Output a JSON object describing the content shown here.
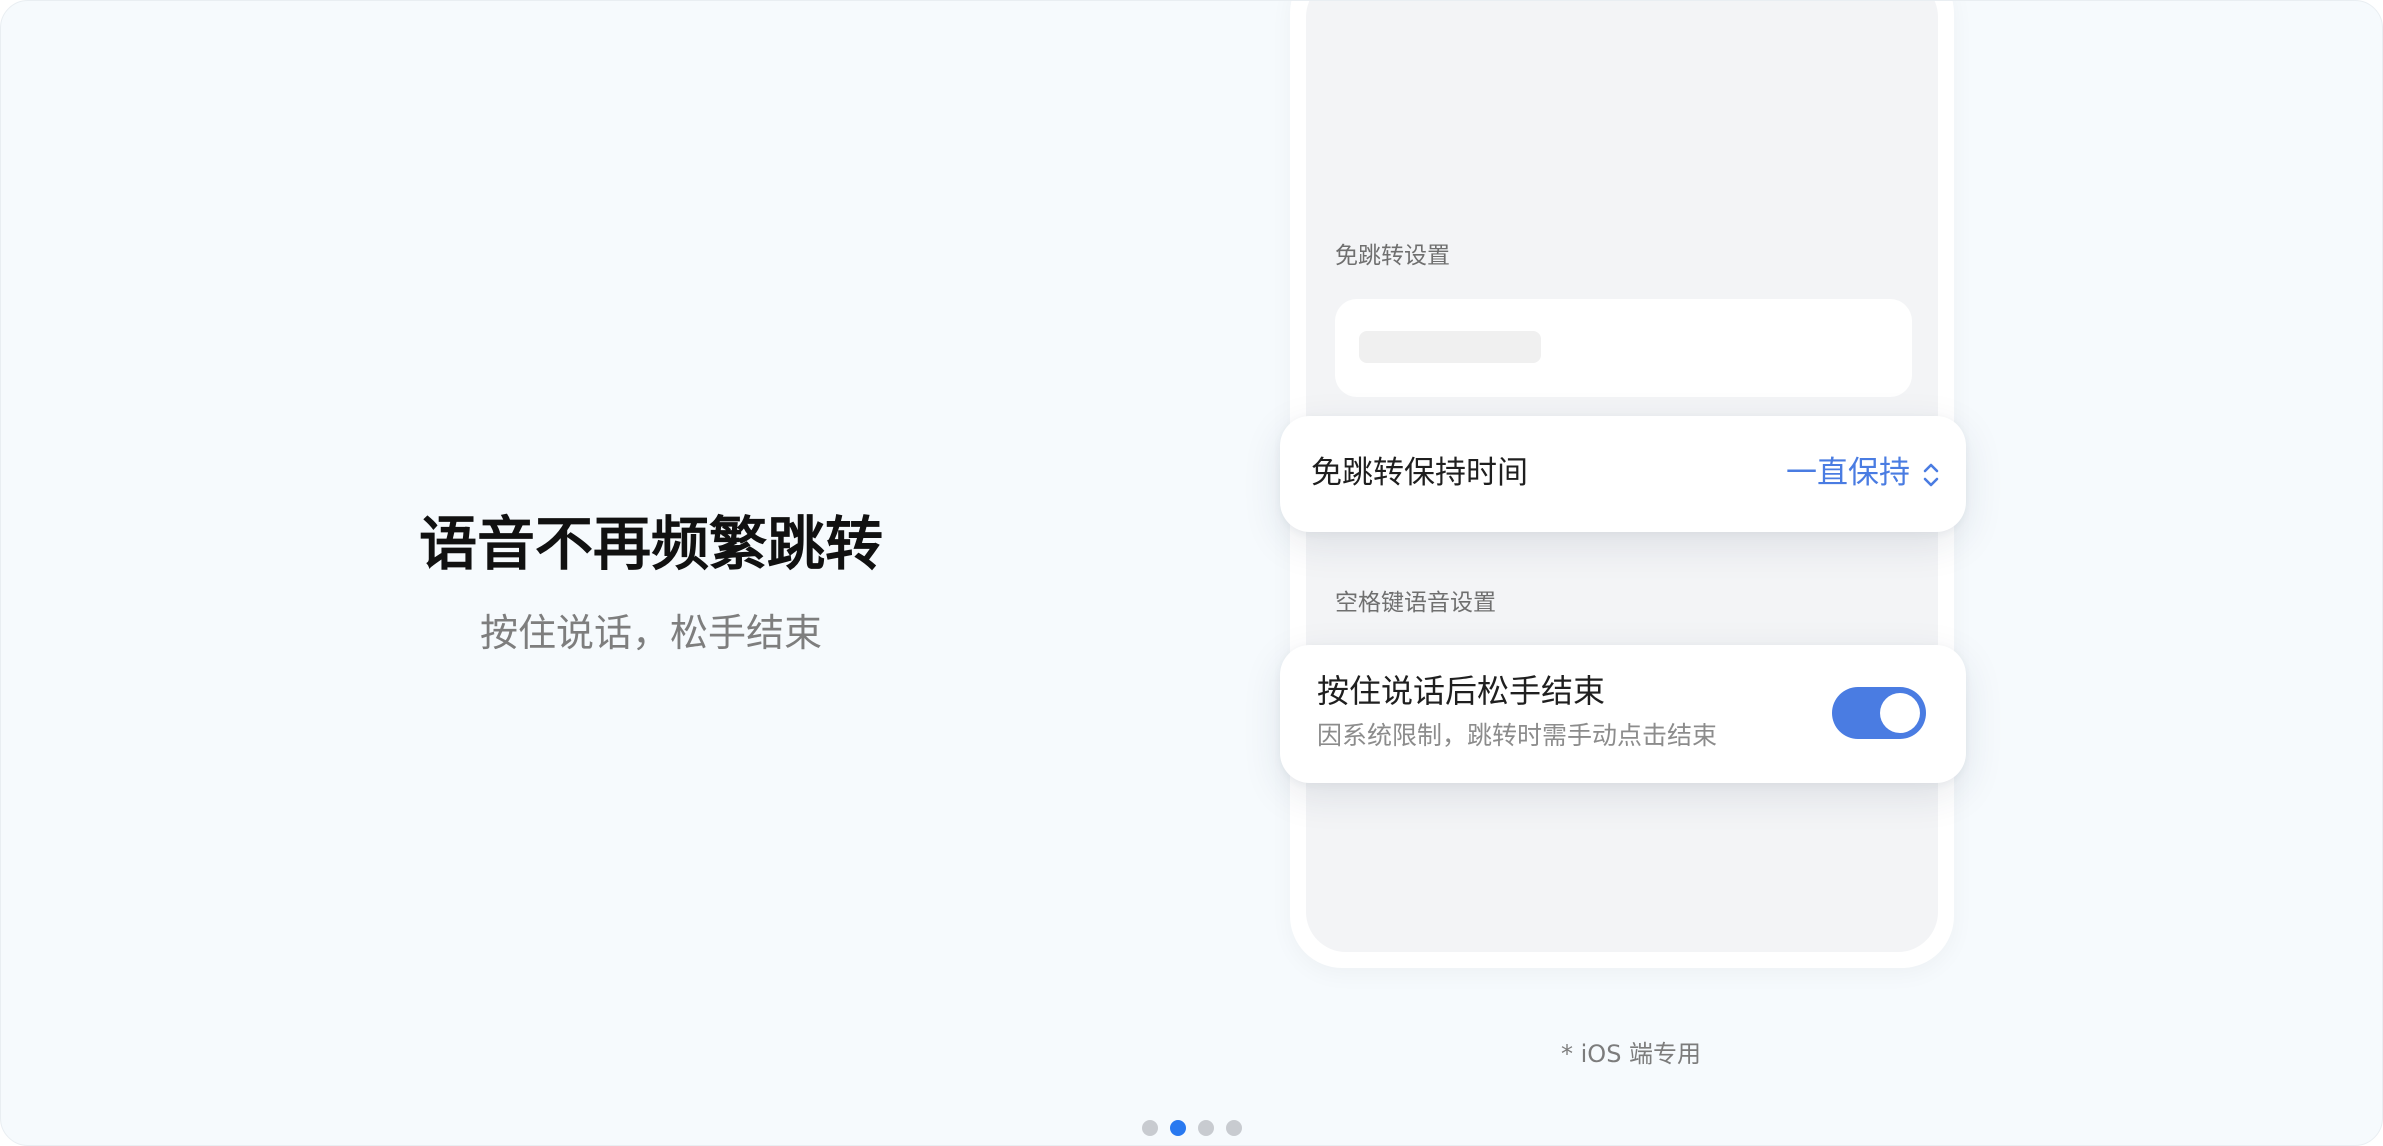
{
  "hero": {
    "title": "语音不再频繁跳转",
    "subtitle": "按住说话，松手结束"
  },
  "phone": {
    "section_no_jump": "免跳转设置",
    "section_space_voice": "空格键语音设置"
  },
  "timer_card": {
    "label": "免跳转保持时间",
    "value": "一直保持",
    "icon": "chevron-up-down-icon"
  },
  "voice_card": {
    "label": "按住说话后松手结束",
    "description": "因系统限制，跳转时需手动点击结束",
    "toggle_on": true
  },
  "footnote": "* iOS 端专用",
  "pager": {
    "count": 4,
    "active_index": 1
  },
  "colors": {
    "background": "#f6fafd",
    "accent": "#4a7ce2",
    "pager_active": "#2979f0",
    "pager_inactive": "#c8cbd0"
  }
}
